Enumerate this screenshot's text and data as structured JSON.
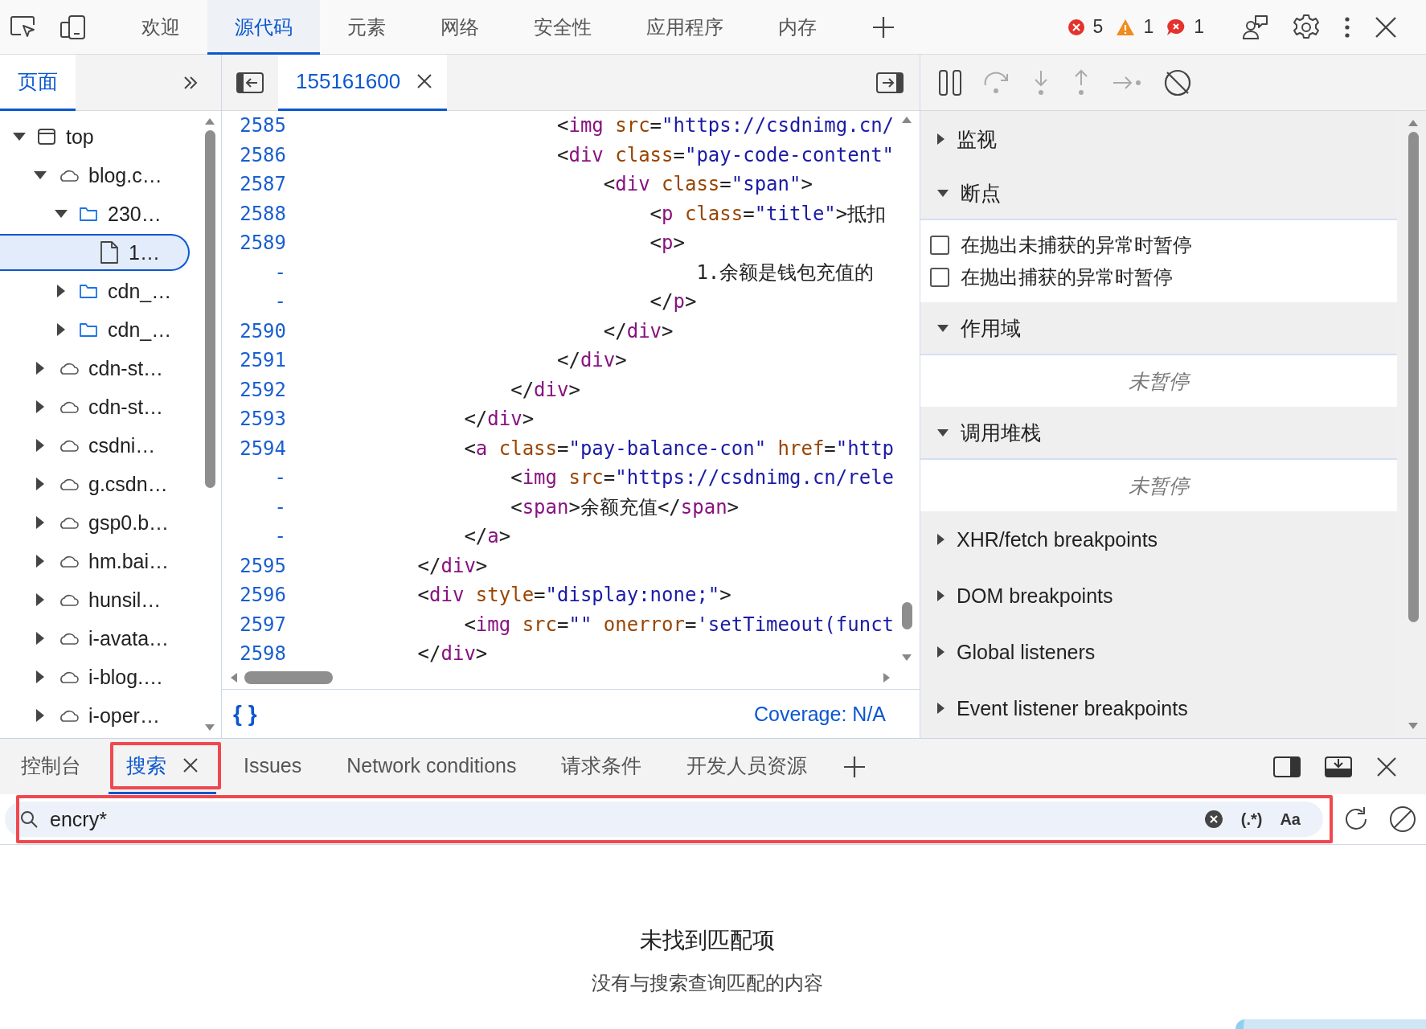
{
  "toolbar": {
    "tabs": [
      {
        "label": "欢迎",
        "selected": false
      },
      {
        "label": "源代码",
        "selected": true
      },
      {
        "label": "元素",
        "selected": false
      },
      {
        "label": "网络",
        "selected": false
      },
      {
        "label": "安全性",
        "selected": false
      },
      {
        "label": "应用程序",
        "selected": false
      },
      {
        "label": "内存",
        "selected": false
      }
    ],
    "counts": [
      {
        "kind": "error",
        "count": "5"
      },
      {
        "kind": "warning",
        "count": "1"
      },
      {
        "kind": "issue",
        "count": "1"
      }
    ]
  },
  "navigator": {
    "tabs": [
      {
        "label": "页面",
        "selected": true
      }
    ],
    "tree": [
      {
        "label": "top",
        "kind": "frame",
        "expanded": true,
        "selected": false,
        "children": [
          {
            "label": "blog.c…",
            "kind": "domain",
            "expanded": true,
            "selected": false,
            "children": [
              {
                "label": "230…",
                "kind": "folder",
                "expanded": true,
                "selected": false,
                "children": [
                  {
                    "label": "1…",
                    "kind": "file",
                    "selected": true
                  }
                ]
              },
              {
                "label": "cdn_…",
                "kind": "folder",
                "expanded": false,
                "selected": false
              },
              {
                "label": "cdn_…",
                "kind": "folder",
                "expanded": false,
                "selected": false
              }
            ]
          },
          {
            "label": "cdn-st…",
            "kind": "domain",
            "expanded": false,
            "selected": false
          },
          {
            "label": "cdn-st…",
            "kind": "domain",
            "expanded": false,
            "selected": false
          },
          {
            "label": "csdni…",
            "kind": "domain",
            "expanded": false,
            "selected": false
          },
          {
            "label": "g.csdn…",
            "kind": "domain",
            "expanded": false,
            "selected": false
          },
          {
            "label": "gsp0.b…",
            "kind": "domain",
            "expanded": false,
            "selected": false
          },
          {
            "label": "hm.bai…",
            "kind": "domain",
            "expanded": false,
            "selected": false
          },
          {
            "label": "hunsil…",
            "kind": "domain",
            "expanded": false,
            "selected": false
          },
          {
            "label": "i-avata…",
            "kind": "domain",
            "expanded": false,
            "selected": false
          },
          {
            "label": "i-blog.…",
            "kind": "domain",
            "expanded": false,
            "selected": false
          },
          {
            "label": "i-oper…",
            "kind": "domain",
            "expanded": false,
            "selected": false
          }
        ]
      }
    ]
  },
  "editor": {
    "tabs": [
      {
        "label": "155161600",
        "selected": true
      }
    ],
    "lines": [
      {
        "number": "2585",
        "tokens": [
          {
            "kind": "punct",
            "text": "                    <"
          },
          {
            "kind": "tag",
            "text": "img"
          },
          {
            "kind": "attr",
            "text": " src"
          },
          {
            "kind": "punct",
            "text": "="
          },
          {
            "kind": "value",
            "text": "\"https://csdnimg.cn/"
          }
        ]
      },
      {
        "number": "2586",
        "tokens": [
          {
            "kind": "punct",
            "text": "                    <"
          },
          {
            "kind": "tag",
            "text": "div"
          },
          {
            "kind": "attr",
            "text": " class"
          },
          {
            "kind": "punct",
            "text": "="
          },
          {
            "kind": "value",
            "text": "\"pay-code-content\""
          }
        ]
      },
      {
        "number": "2587",
        "tokens": [
          {
            "kind": "punct",
            "text": "                        <"
          },
          {
            "kind": "tag",
            "text": "div"
          },
          {
            "kind": "attr",
            "text": " class"
          },
          {
            "kind": "punct",
            "text": "="
          },
          {
            "kind": "value",
            "text": "\"span\""
          },
          {
            "kind": "punct",
            "text": ">"
          }
        ]
      },
      {
        "number": "2588",
        "tokens": [
          {
            "kind": "punct",
            "text": "                            <"
          },
          {
            "kind": "tag",
            "text": "p"
          },
          {
            "kind": "attr",
            "text": " class"
          },
          {
            "kind": "punct",
            "text": "="
          },
          {
            "kind": "value",
            "text": "\"title\""
          },
          {
            "kind": "punct",
            "text": ">"
          },
          {
            "kind": "plain",
            "text": "抵扣"
          }
        ]
      },
      {
        "number": "2589",
        "tokens": [
          {
            "kind": "punct",
            "text": "                            <"
          },
          {
            "kind": "tag",
            "text": "p"
          },
          {
            "kind": "punct",
            "text": ">"
          }
        ]
      },
      {
        "number": "-",
        "tokens": [
          {
            "kind": "plain",
            "text": "                                1.余额是钱包充值的"
          }
        ]
      },
      {
        "number": "-",
        "tokens": [
          {
            "kind": "punct",
            "text": "                            </"
          },
          {
            "kind": "tag",
            "text": "p"
          },
          {
            "kind": "punct",
            "text": ">"
          }
        ]
      },
      {
        "number": "2590",
        "tokens": [
          {
            "kind": "punct",
            "text": "                        </"
          },
          {
            "kind": "tag",
            "text": "div"
          },
          {
            "kind": "punct",
            "text": ">"
          }
        ]
      },
      {
        "number": "2591",
        "tokens": [
          {
            "kind": "punct",
            "text": "                    </"
          },
          {
            "kind": "tag",
            "text": "div"
          },
          {
            "kind": "punct",
            "text": ">"
          }
        ]
      },
      {
        "number": "2592",
        "tokens": [
          {
            "kind": "punct",
            "text": "                </"
          },
          {
            "kind": "tag",
            "text": "div"
          },
          {
            "kind": "punct",
            "text": ">"
          }
        ]
      },
      {
        "number": "2593",
        "tokens": [
          {
            "kind": "punct",
            "text": "            </"
          },
          {
            "kind": "tag",
            "text": "div"
          },
          {
            "kind": "punct",
            "text": ">"
          }
        ]
      },
      {
        "number": "2594",
        "tokens": [
          {
            "kind": "punct",
            "text": "            <"
          },
          {
            "kind": "tag",
            "text": "a"
          },
          {
            "kind": "attr",
            "text": " class"
          },
          {
            "kind": "punct",
            "text": "="
          },
          {
            "kind": "value",
            "text": "\"pay-balance-con\""
          },
          {
            "kind": "attr",
            "text": " href"
          },
          {
            "kind": "punct",
            "text": "="
          },
          {
            "kind": "value",
            "text": "\"http"
          }
        ]
      },
      {
        "number": "-",
        "tokens": [
          {
            "kind": "punct",
            "text": "                <"
          },
          {
            "kind": "tag",
            "text": "img"
          },
          {
            "kind": "attr",
            "text": " src"
          },
          {
            "kind": "punct",
            "text": "="
          },
          {
            "kind": "value",
            "text": "\"https://csdnimg.cn/rele"
          }
        ]
      },
      {
        "number": "-",
        "tokens": [
          {
            "kind": "punct",
            "text": "                <"
          },
          {
            "kind": "tag",
            "text": "span"
          },
          {
            "kind": "punct",
            "text": ">"
          },
          {
            "kind": "plain",
            "text": "余额充值"
          },
          {
            "kind": "punct",
            "text": "</"
          },
          {
            "kind": "tag",
            "text": "span"
          },
          {
            "kind": "punct",
            "text": ">"
          }
        ]
      },
      {
        "number": "-",
        "tokens": [
          {
            "kind": "punct",
            "text": "            </"
          },
          {
            "kind": "tag",
            "text": "a"
          },
          {
            "kind": "punct",
            "text": ">"
          }
        ]
      },
      {
        "number": "2595",
        "tokens": [
          {
            "kind": "punct",
            "text": "        </"
          },
          {
            "kind": "tag",
            "text": "div"
          },
          {
            "kind": "punct",
            "text": ">"
          }
        ]
      },
      {
        "number": "2596",
        "tokens": [
          {
            "kind": "punct",
            "text": "        <"
          },
          {
            "kind": "tag",
            "text": "div"
          },
          {
            "kind": "attr",
            "text": " style"
          },
          {
            "kind": "punct",
            "text": "="
          },
          {
            "kind": "value",
            "text": "\"display:none;\""
          },
          {
            "kind": "punct",
            "text": ">"
          }
        ]
      },
      {
        "number": "2597",
        "tokens": [
          {
            "kind": "punct",
            "text": "            <"
          },
          {
            "kind": "tag",
            "text": "img"
          },
          {
            "kind": "attr",
            "text": " src"
          },
          {
            "kind": "punct",
            "text": "="
          },
          {
            "kind": "value",
            "text": "\"\""
          },
          {
            "kind": "attr",
            "text": " onerror"
          },
          {
            "kind": "punct",
            "text": "="
          },
          {
            "kind": "value",
            "text": "'setTimeout(funct"
          }
        ]
      },
      {
        "number": "2598",
        "tokens": [
          {
            "kind": "punct",
            "text": "        </"
          },
          {
            "kind": "tag",
            "text": "div"
          },
          {
            "kind": "punct",
            "text": ">"
          }
        ]
      }
    ],
    "format_button": "{ }",
    "coverage": "Coverage: N/A"
  },
  "debugger": {
    "sections": [
      {
        "title": "监视",
        "expanded": false
      },
      {
        "title": "断点",
        "expanded": true,
        "checkboxes": [
          {
            "label": "在抛出未捕获的异常时暂停",
            "checked": false
          },
          {
            "label": "在抛出捕获的异常时暂停",
            "checked": false
          }
        ]
      },
      {
        "title": "作用域",
        "expanded": true,
        "message": "未暂停"
      },
      {
        "title": "调用堆栈",
        "expanded": true,
        "message": "未暂停"
      },
      {
        "title": "XHR/fetch breakpoints",
        "expanded": false
      },
      {
        "title": "DOM breakpoints",
        "expanded": false
      },
      {
        "title": "Global listeners",
        "expanded": false
      },
      {
        "title": "Event listener breakpoints",
        "expanded": false
      }
    ]
  },
  "drawer": {
    "tabs": [
      {
        "label": "控制台",
        "selected": false,
        "closable": false,
        "highlighted": false
      },
      {
        "label": "搜索",
        "selected": true,
        "closable": true,
        "highlighted": true
      },
      {
        "label": "Issues",
        "selected": false,
        "closable": false,
        "highlighted": false
      },
      {
        "label": "Network conditions",
        "selected": false,
        "closable": false,
        "highlighted": false
      },
      {
        "label": "请求条件",
        "selected": false,
        "closable": false,
        "highlighted": false
      },
      {
        "label": "开发人员资源",
        "selected": false,
        "closable": false,
        "highlighted": false
      }
    ],
    "search": {
      "value": "encry*",
      "highlighted": true,
      "regex_toggle": "(.*)",
      "case_toggle": "Aa"
    },
    "result": {
      "title": "未找到匹配项",
      "message": "没有与搜索查询匹配的内容"
    }
  }
}
